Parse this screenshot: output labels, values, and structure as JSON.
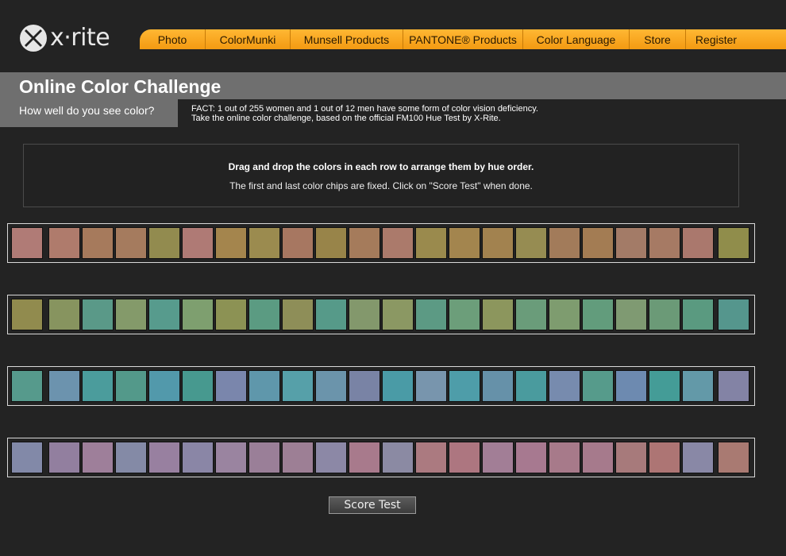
{
  "logo": {
    "text": "x·rite"
  },
  "nav": [
    "Photo",
    "ColorMunki",
    "Munsell Products",
    "PANTONE® Products",
    "Color Language",
    "Store",
    "Register"
  ],
  "header": {
    "title": "Online Color Challenge",
    "subtitle": "How well do you see color?",
    "fact_line1": "FACT: 1 out of 255 women and 1 out of 12 men have some form of color vision deficiency.",
    "fact_line2": "Take the online color challenge, based on the official FM100 Hue Test by X-Rite."
  },
  "instructions": {
    "line1": "Drag and drop the colors in each row to arrange them by hue order.",
    "line2": "The first and last color chips are fixed. Click on \"Score Test\" when done."
  },
  "rows": [
    [
      "#b07b76",
      "#af7b6c",
      "#a67a5c",
      "#a57b5e",
      "#928b4f",
      "#af7a75",
      "#a4854d",
      "#9b8b4f",
      "#a77761",
      "#988449",
      "#a57b5b",
      "#ab7a6b",
      "#9a8a4d",
      "#a3854e",
      "#a2824f",
      "#968c52",
      "#a27b5a",
      "#a37c53",
      "#a37b67",
      "#a67a64",
      "#aa786d",
      "#908d4b"
    ],
    [
      "#918b4e",
      "#87945f",
      "#5a9988",
      "#849a6a",
      "#579b8d",
      "#7e9f6f",
      "#8c9254",
      "#5b9b82",
      "#8e8e58",
      "#569a89",
      "#83986c",
      "#8b9863",
      "#5c9a84",
      "#6c9e7a",
      "#8c965d",
      "#6a9c7a",
      "#7e9c6f",
      "#629c7c",
      "#7f9a72",
      "#6b9a77",
      "#5a9a80",
      "#55968d"
    ],
    [
      "#569a8c",
      "#6c93ae",
      "#4b9c9c",
      "#53998a",
      "#5299ab",
      "#47998f",
      "#7a86ac",
      "#5f97ab",
      "#56a0a9",
      "#6b94ab",
      "#7983a5",
      "#4a9ba6",
      "#7895ad",
      "#4e9da9",
      "#6691a9",
      "#4a9b9e",
      "#778bae",
      "#569b8b",
      "#6d8ab0",
      "#449c97",
      "#6399a8",
      "#8383a5"
    ],
    [
      "#8289a8",
      "#927f9f",
      "#9e7f9a",
      "#848aa6",
      "#9880a0",
      "#8a86a6",
      "#9a84a0",
      "#9a7f98",
      "#9d7f95",
      "#8c88a6",
      "#a87a8c",
      "#8b8aa3",
      "#ab7a80",
      "#ad7680",
      "#a27e96",
      "#a77990",
      "#a77a8a",
      "#a67a8c",
      "#a77a7b",
      "#ad7574",
      "#8988a6",
      "#a97a72"
    ]
  ],
  "button": {
    "label": "Score Test"
  }
}
